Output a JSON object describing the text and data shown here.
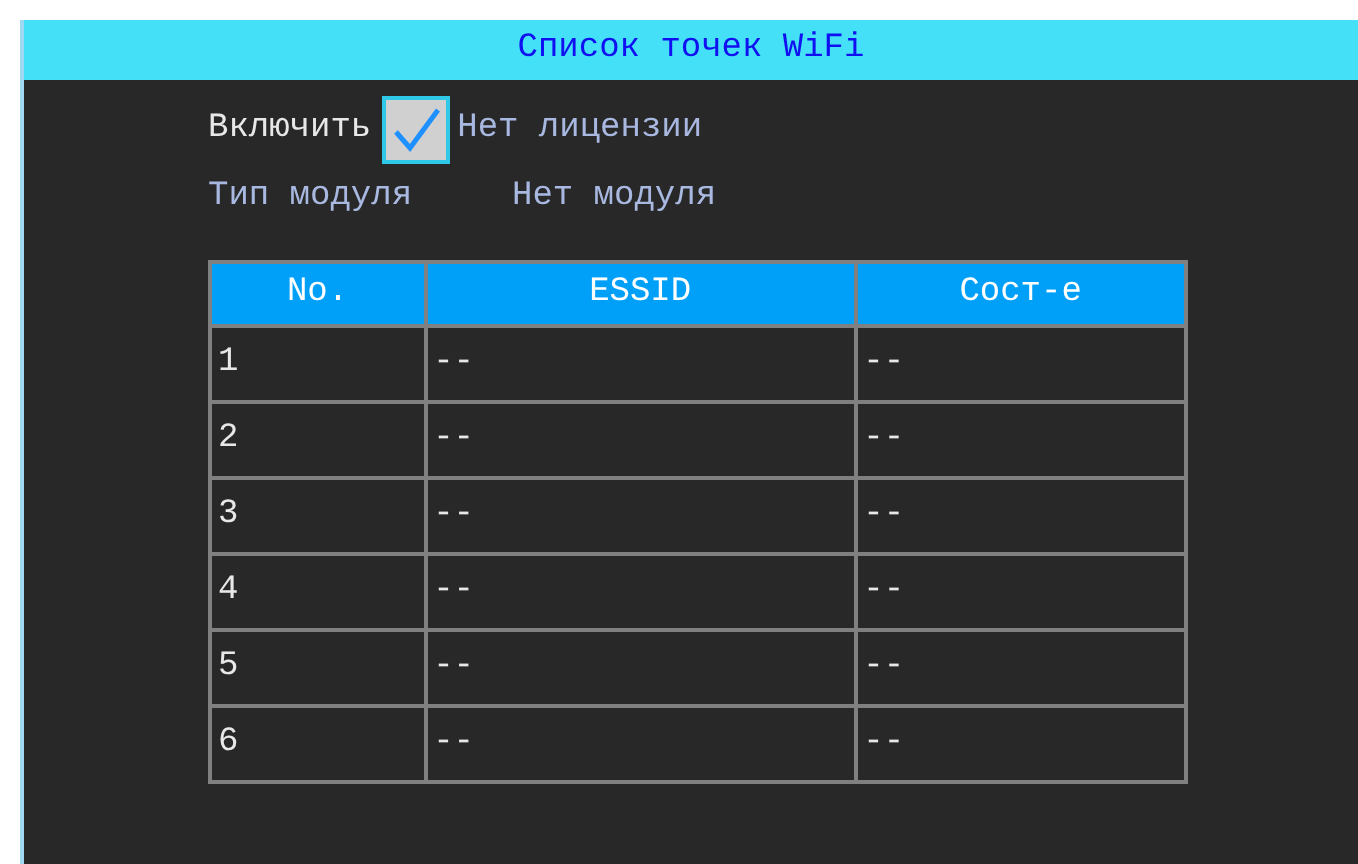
{
  "window": {
    "title": "Список точек WiFi"
  },
  "enable": {
    "label": "Включить",
    "checked": true,
    "status": "Нет лицензии"
  },
  "module": {
    "label": "Тип модуля",
    "value": "Нет модуля"
  },
  "table": {
    "columns": [
      "No.",
      "ESSID",
      "Сост-е"
    ],
    "rows": [
      {
        "no": "1",
        "essid": "--",
        "state": "--"
      },
      {
        "no": "2",
        "essid": "--",
        "state": "--"
      },
      {
        "no": "3",
        "essid": "--",
        "state": "--"
      },
      {
        "no": "4",
        "essid": "--",
        "state": "--"
      },
      {
        "no": "5",
        "essid": "--",
        "state": "--"
      },
      {
        "no": "6",
        "essid": "--",
        "state": "--"
      }
    ]
  }
}
